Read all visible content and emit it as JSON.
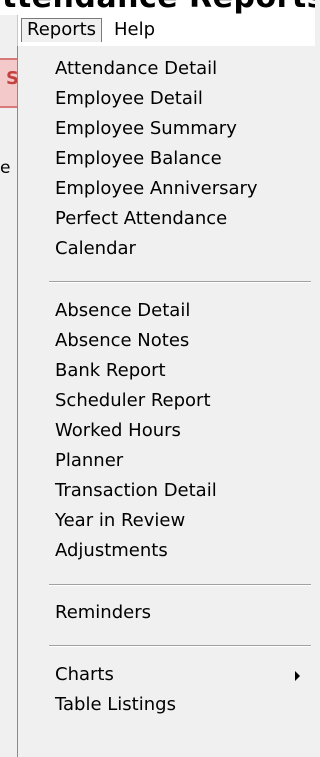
{
  "window": {
    "title_fragment": "ttendance Reports"
  },
  "menubar": {
    "items": [
      {
        "label": "Reports"
      },
      {
        "label": "Help"
      }
    ]
  },
  "background": {
    "red_fragment": "S",
    "text_fragment": "e"
  },
  "reports_menu": {
    "groups": [
      {
        "items": [
          {
            "label": "Attendance Detail"
          },
          {
            "label": "Employee Detail"
          },
          {
            "label": "Employee Summary"
          },
          {
            "label": "Employee Balance"
          },
          {
            "label": "Employee Anniversary"
          },
          {
            "label": "Perfect Attendance"
          },
          {
            "label": "Calendar"
          }
        ]
      },
      {
        "items": [
          {
            "label": "Absence Detail"
          },
          {
            "label": "Absence Notes"
          },
          {
            "label": "Bank Report"
          },
          {
            "label": "Scheduler Report"
          },
          {
            "label": "Worked Hours"
          },
          {
            "label": "Planner"
          },
          {
            "label": "Transaction Detail"
          },
          {
            "label": "Year in Review"
          },
          {
            "label": "Adjustments"
          }
        ]
      },
      {
        "items": [
          {
            "label": "Reminders"
          }
        ]
      },
      {
        "items": [
          {
            "label": "Charts",
            "has_submenu": true
          },
          {
            "label": "Table Listings"
          }
        ]
      }
    ]
  }
}
